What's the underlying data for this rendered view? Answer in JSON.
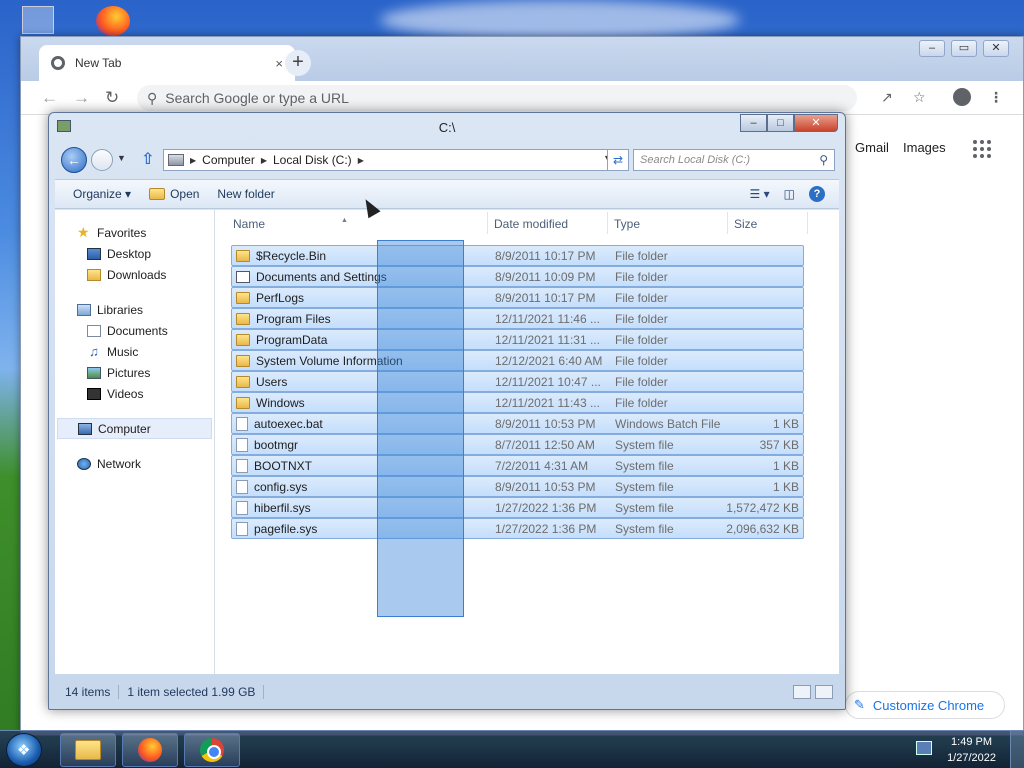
{
  "chrome": {
    "tab_title": "New Tab",
    "tab_close": "×",
    "new_tab": "+",
    "omnibox_placeholder": "Search Google or type a URL",
    "links": [
      "Gmail",
      "Images"
    ],
    "customize_label": "Customize Chrome",
    "window_controls": [
      "–",
      "▭",
      "✕"
    ]
  },
  "explorer": {
    "title": "C:\\",
    "breadcrumb": [
      "Computer",
      "Local Disk (C:)"
    ],
    "search_placeholder": "Search Local Disk (C:)",
    "toolbar": {
      "organize": "Organize ▾",
      "open": "Open",
      "new_folder": "New folder"
    },
    "columns": [
      "Name",
      "Date modified",
      "Type",
      "Size"
    ],
    "nav": {
      "favorites": "Favorites",
      "favorites_items": [
        "Desktop",
        "Downloads"
      ],
      "libraries": "Libraries",
      "libraries_items": [
        "Documents",
        "Music",
        "Pictures",
        "Videos"
      ],
      "computer": "Computer",
      "network": "Network"
    },
    "files": [
      {
        "name": "$Recycle.Bin",
        "date": "8/9/2011 10:17 PM",
        "type": "File folder",
        "size": "",
        "icon": "folder"
      },
      {
        "name": "Documents and Settings",
        "date": "8/9/2011 10:09 PM",
        "type": "File folder",
        "size": "",
        "icon": "link"
      },
      {
        "name": "PerfLogs",
        "date": "8/9/2011 10:17 PM",
        "type": "File folder",
        "size": "",
        "icon": "folder"
      },
      {
        "name": "Program Files",
        "date": "12/11/2021 11:46 ...",
        "type": "File folder",
        "size": "",
        "icon": "folder"
      },
      {
        "name": "ProgramData",
        "date": "12/11/2021 11:31 ...",
        "type": "File folder",
        "size": "",
        "icon": "folder"
      },
      {
        "name": "System Volume Information",
        "date": "12/12/2021 6:40 AM",
        "type": "File folder",
        "size": "",
        "icon": "folder"
      },
      {
        "name": "Users",
        "date": "12/11/2021 10:47 ...",
        "type": "File folder",
        "size": "",
        "icon": "folder"
      },
      {
        "name": "Windows",
        "date": "12/11/2021 11:43 ...",
        "type": "File folder",
        "size": "",
        "icon": "folder"
      },
      {
        "name": "autoexec.bat",
        "date": "8/9/2011 10:53 PM",
        "type": "Windows Batch File",
        "size": "1 KB",
        "icon": "file"
      },
      {
        "name": "bootmgr",
        "date": "8/7/2011 12:50 AM",
        "type": "System file",
        "size": "357 KB",
        "icon": "file"
      },
      {
        "name": "BOOTNXT",
        "date": "7/2/2011 4:31 AM",
        "type": "System file",
        "size": "1 KB",
        "icon": "file"
      },
      {
        "name": "config.sys",
        "date": "8/9/2011 10:53 PM",
        "type": "System file",
        "size": "1 KB",
        "icon": "file"
      },
      {
        "name": "hiberfil.sys",
        "date": "1/27/2022 1:36 PM",
        "type": "System file",
        "size": "1,572,472 KB",
        "icon": "file"
      },
      {
        "name": "pagefile.sys",
        "date": "1/27/2022 1:36 PM",
        "type": "System file",
        "size": "2,096,632 KB",
        "icon": "file"
      }
    ],
    "status": {
      "count": "14 items",
      "selection": "1 item selected  1.99 GB"
    }
  },
  "taskbar": {
    "time": "1:49 PM",
    "date": "1/27/2022"
  },
  "colors": {
    "selection_fill": "#c4defc",
    "selection_border": "#84acdd",
    "accent": "#1a73e8"
  }
}
